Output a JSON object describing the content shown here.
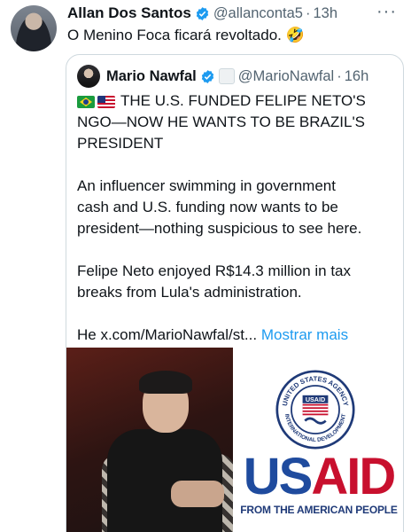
{
  "tweet": {
    "author_name": "Allan Dos Santos",
    "handle": "@allanconta5",
    "time": "13h",
    "text": "O Menino Foca ficará revoltado. 🤣",
    "more_icon": "more-dots-icon"
  },
  "quoted": {
    "author_name": "Mario Nawfal",
    "handle": "@MarioNawfal",
    "time": "16h",
    "headline_line1": "THE U.S. FUNDED FELIPE NETO'S",
    "headline_line2": "NGO—NOW HE WANTS TO BE BRAZIL'S",
    "headline_line3": "PRESIDENT",
    "para2_line1": "An influencer swimming in government",
    "para2_line2": "cash and U.S. funding now wants to be",
    "para2_line3": "president—nothing suspicious to see here.",
    "para3_line1": "Felipe Neto enjoyed R$14.3 million in tax",
    "para3_line2": "breaks from Lula's administration.",
    "para4_text": "He x.com/MarioNawfal/st...",
    "show_more": "Mostrar mais"
  },
  "media": {
    "seal_top": "UNITED STATES AGENCY",
    "seal_bottom": "INTERNATIONAL DEVELOPMENT",
    "seal_center": "USAID",
    "logo_us": "US",
    "logo_aid": "AID",
    "tagline": "FROM THE AMERICAN PEOPLE"
  },
  "colors": {
    "link": "#1d9bf0",
    "secondary_text": "#536471",
    "usaid_blue": "#1f4b9e",
    "usaid_red": "#c8102e"
  }
}
